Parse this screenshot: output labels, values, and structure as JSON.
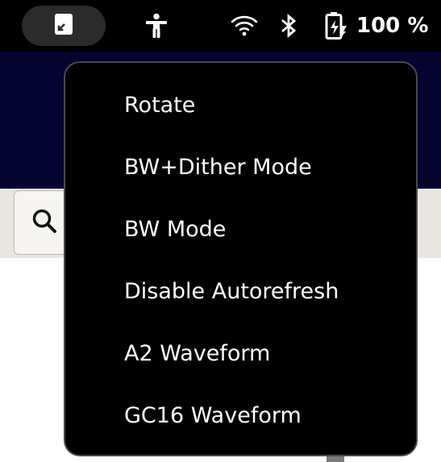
{
  "status_bar": {
    "app_icon": "tablet-icon",
    "accessibility_icon": "accessibility-icon",
    "wifi_icon": "wifi-icon",
    "bluetooth_icon": "bluetooth-icon",
    "battery_icon": "battery-charging-icon",
    "battery_text": "100 %"
  },
  "menu": {
    "items": [
      {
        "label": "Rotate"
      },
      {
        "label": "BW+Dither Mode"
      },
      {
        "label": "BW Mode"
      },
      {
        "label": "Disable Autorefresh"
      },
      {
        "label": "A2 Waveform"
      },
      {
        "label": "GC16 Waveform"
      }
    ]
  },
  "background": {
    "search_icon": "search-icon"
  },
  "colors": {
    "menu_bg": "#000000",
    "menu_border": "#4a4a4a",
    "pill_bg": "#2b2b2b",
    "navy": "#050530",
    "toolbar_bg": "#e9e6e1"
  }
}
